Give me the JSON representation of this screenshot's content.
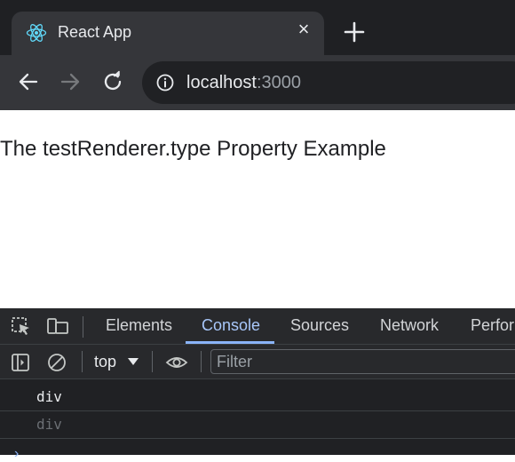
{
  "browser": {
    "tab": {
      "title": "React App",
      "icon": "react-logo-icon",
      "close_glyph": "×"
    },
    "new_tab_icon": "plus-icon",
    "address": {
      "host": "localhost",
      "port": ":3000"
    }
  },
  "page": {
    "text": "The testRenderer.type Property Example"
  },
  "devtools": {
    "tabs": [
      {
        "label": "Elements"
      },
      {
        "label": "Console",
        "active": true
      },
      {
        "label": "Sources"
      },
      {
        "label": "Network"
      },
      {
        "label": "Perform"
      }
    ],
    "console": {
      "context": "top",
      "filter_placeholder": "Filter",
      "logs": [
        {
          "text": "div",
          "color": "#e8eaed"
        },
        {
          "text": "div",
          "color": "#6b6f74"
        }
      ],
      "prompt": "›"
    }
  },
  "colors": {
    "accent": "#8ab4f8",
    "react": "#61dafb"
  }
}
